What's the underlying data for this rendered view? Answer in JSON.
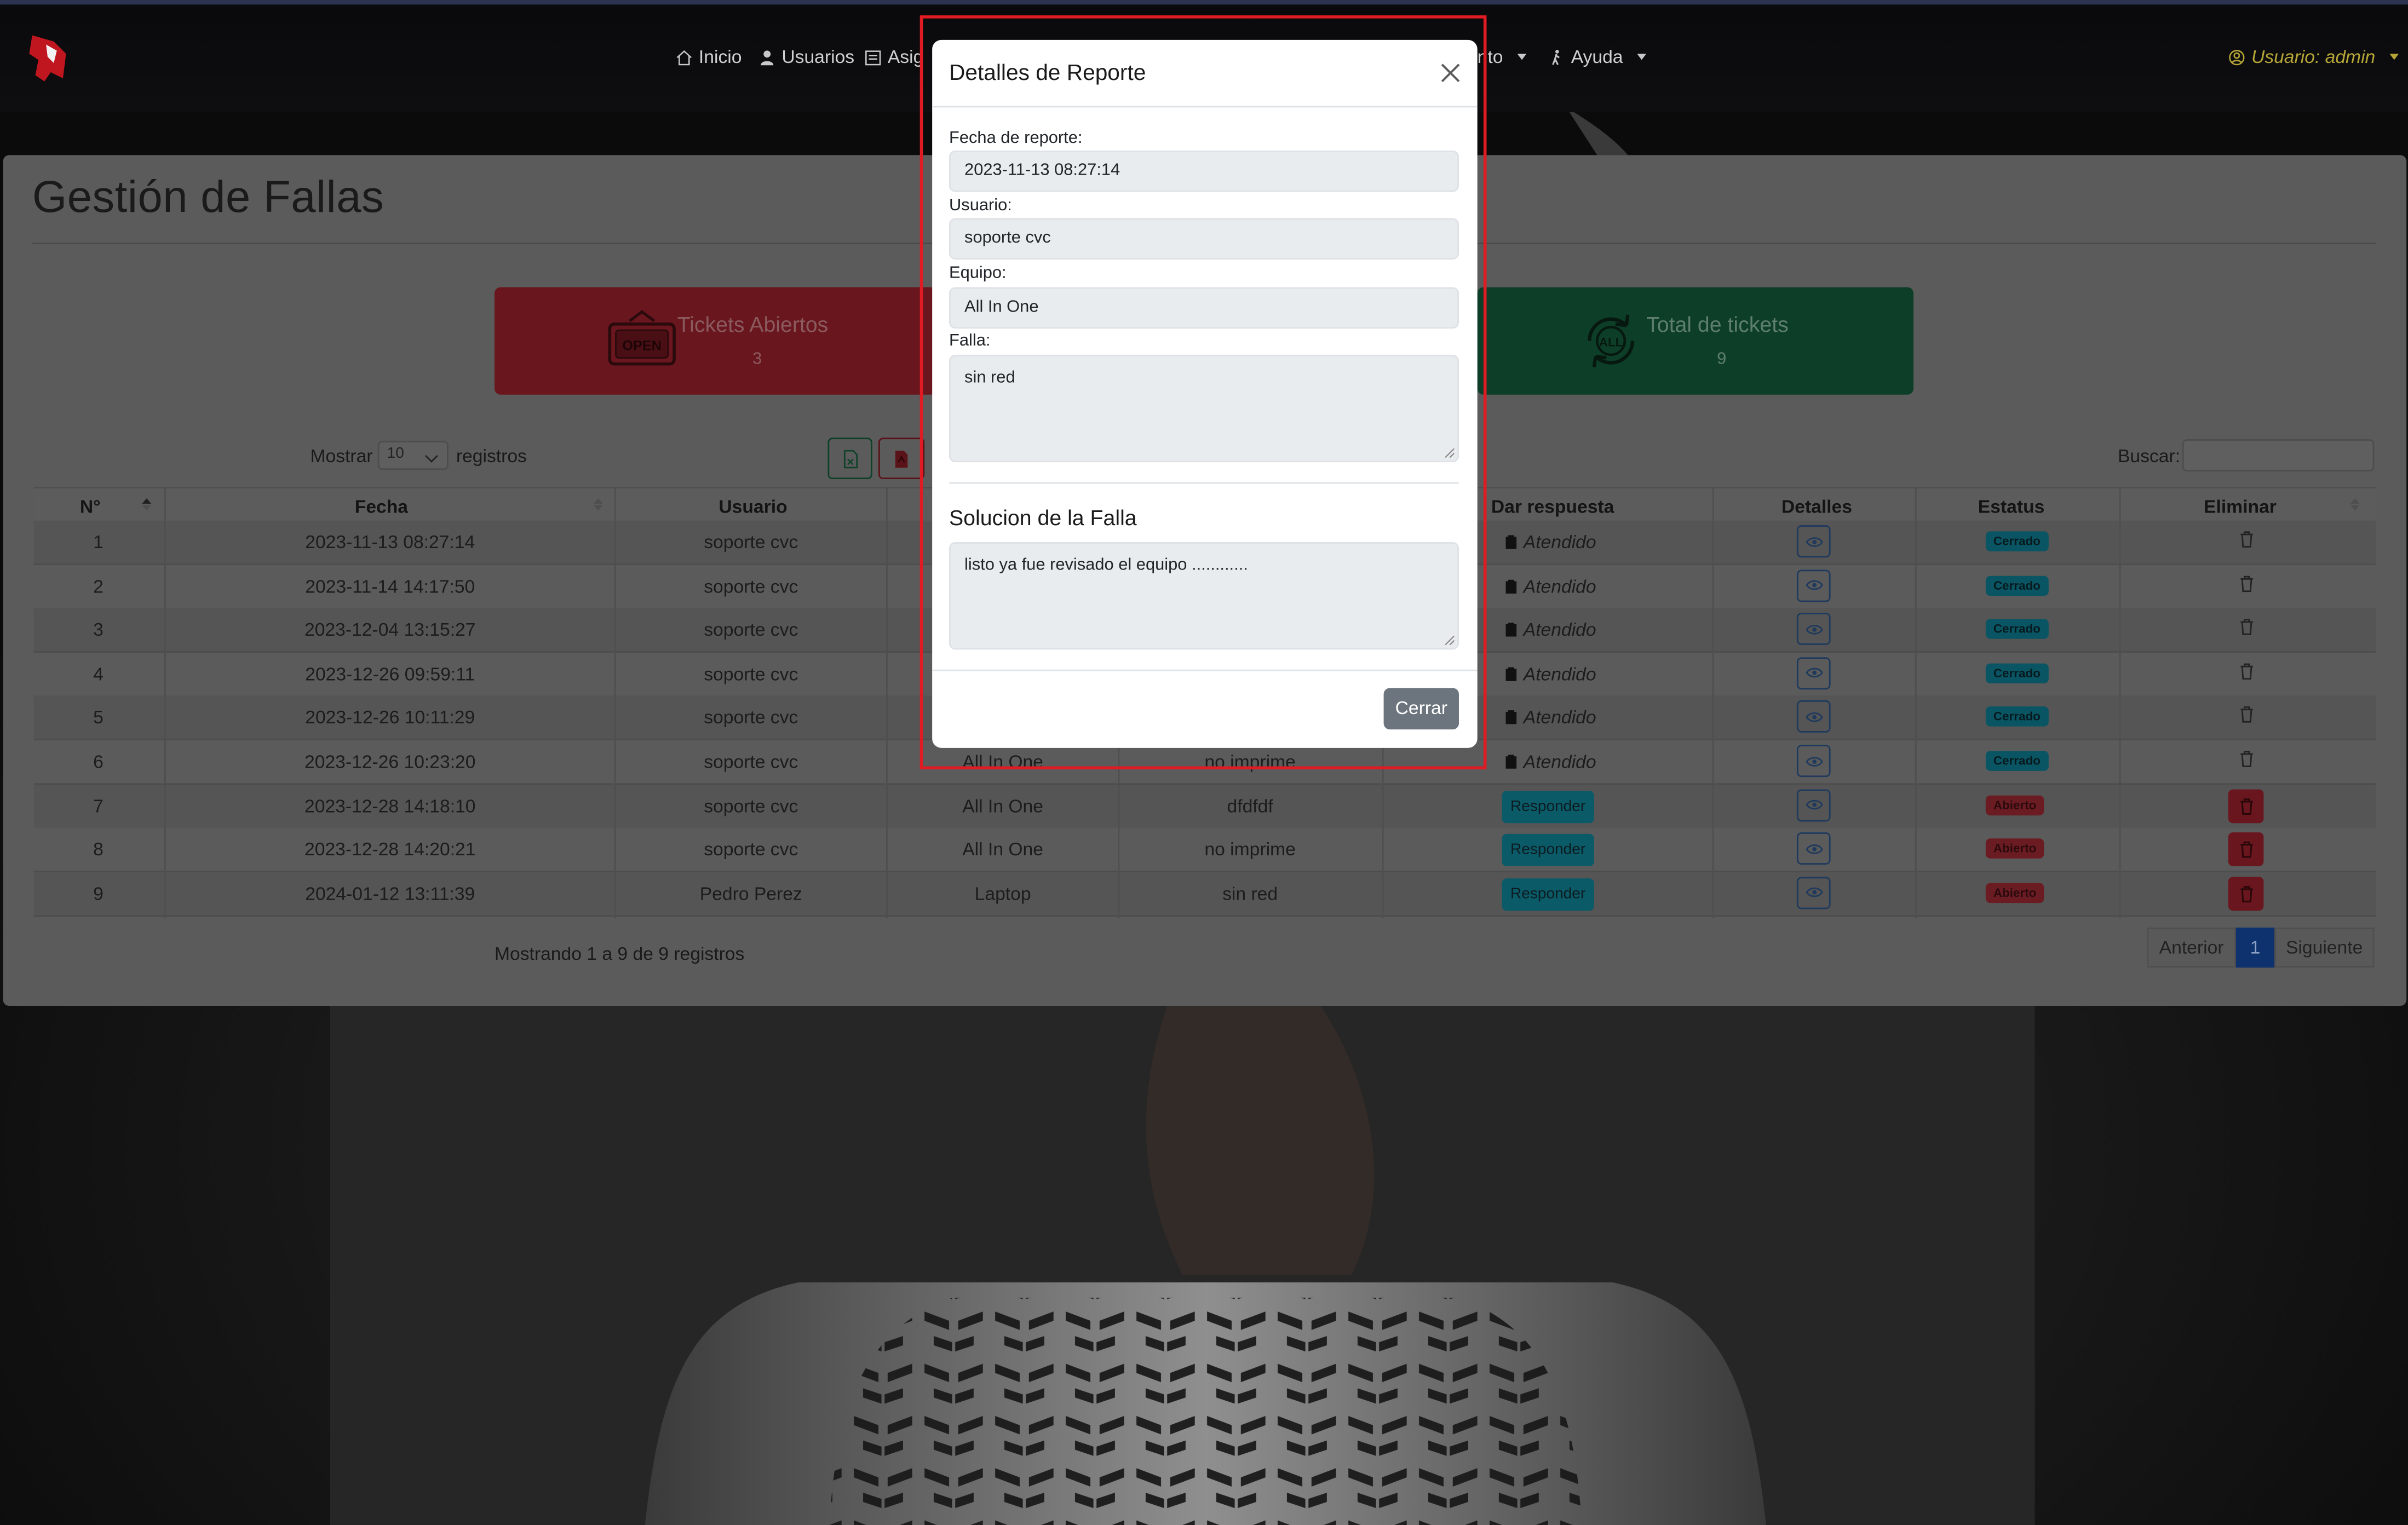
{
  "nav": {
    "items": [
      {
        "label": "Inicio",
        "icon": "home-icon"
      },
      {
        "label": "Usuarios",
        "icon": "user-icon"
      },
      {
        "label": "Asig",
        "icon": "calendar-icon"
      },
      {
        "label": "nto",
        "icon": "caret"
      },
      {
        "label": "Ayuda",
        "icon": "person-walk-icon"
      }
    ],
    "user_label": "Usuario: admin"
  },
  "page": {
    "title": "Gestión de Fallas",
    "stats": [
      {
        "label": "Tickets Abiertos",
        "count": "3",
        "icon": "open-sign-icon",
        "color": "#dc3545"
      },
      {
        "label": "Total de tickets",
        "count": "9",
        "icon": "all-cycle-icon",
        "color": "#198754"
      }
    ],
    "length_prefix": "Mostrar",
    "length_value": "10",
    "length_suffix": "registros",
    "search_label": "Buscar:",
    "search_value": ""
  },
  "table": {
    "headers": [
      "N°",
      "Fecha",
      "Usuario",
      "Dar respuesta",
      "Detalles",
      "Estatus",
      "Eliminar"
    ],
    "rows": [
      {
        "n": "1",
        "fecha": "2023-11-13 08:27:14",
        "usuario": "soporte cvc",
        "equipo": "",
        "falla": "",
        "respuesta": "Atendido",
        "estatus": "Cerrado"
      },
      {
        "n": "2",
        "fecha": "2023-11-14 14:17:50",
        "usuario": "soporte cvc",
        "equipo": "",
        "falla": "",
        "respuesta": "Atendido",
        "estatus": "Cerrado"
      },
      {
        "n": "3",
        "fecha": "2023-12-04 13:15:27",
        "usuario": "soporte cvc",
        "equipo": "",
        "falla": "",
        "respuesta": "Atendido",
        "estatus": "Cerrado"
      },
      {
        "n": "4",
        "fecha": "2023-12-26 09:59:11",
        "usuario": "soporte cvc",
        "equipo": "",
        "falla": "",
        "respuesta": "Atendido",
        "estatus": "Cerrado"
      },
      {
        "n": "5",
        "fecha": "2023-12-26 10:11:29",
        "usuario": "soporte cvc",
        "equipo": "",
        "falla": "",
        "respuesta": "Atendido",
        "estatus": "Cerrado"
      },
      {
        "n": "6",
        "fecha": "2023-12-26 10:23:20",
        "usuario": "soporte cvc",
        "equipo": "All In One",
        "falla": "no imprime",
        "respuesta": "Atendido",
        "estatus": "Cerrado"
      },
      {
        "n": "7",
        "fecha": "2023-12-28 14:18:10",
        "usuario": "soporte cvc",
        "equipo": "All In One",
        "falla": "dfdfdf",
        "respuesta": "Responder",
        "estatus": "Abierto"
      },
      {
        "n": "8",
        "fecha": "2023-12-28 14:20:21",
        "usuario": "soporte cvc",
        "equipo": "All In One",
        "falla": "no imprime",
        "respuesta": "Responder",
        "estatus": "Abierto"
      },
      {
        "n": "9",
        "fecha": "2024-01-12 13:11:39",
        "usuario": "Pedro Perez",
        "equipo": "Laptop",
        "falla": "sin red",
        "respuesta": "Responder",
        "estatus": "Abierto"
      }
    ],
    "info": "Mostrando 1 a 9 de 9 registros",
    "pagination": {
      "prev": "Anterior",
      "current": "1",
      "next": "Siguiente"
    }
  },
  "modal": {
    "title": "Detalles de Reporte",
    "fecha_label": "Fecha de reporte:",
    "fecha_value": "2023-11-13 08:27:14",
    "usuario_label": "Usuario:",
    "usuario_value": "soporte cvc",
    "equipo_label": "Equipo:",
    "equipo_value": "All In One",
    "falla_label": "Falla:",
    "falla_value": "sin red",
    "solucion_title": "Solucion de la Falla",
    "solucion_value": "listo ya fue revisado el equipo ............",
    "close_label": "Cerrar"
  },
  "colors": {
    "highlight": "#e01b24",
    "danger": "#dc3545",
    "success": "#198754",
    "info": "#0dcaf0",
    "primary": "#0d6efd",
    "user_accent": "#b6a637"
  }
}
